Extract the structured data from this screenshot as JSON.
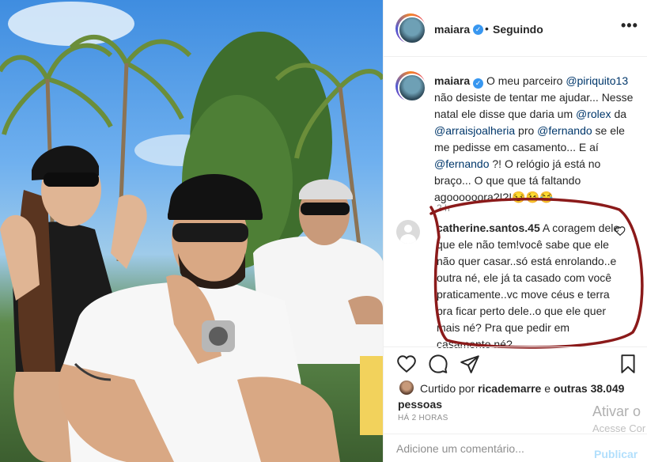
{
  "post": {
    "username": "maiara",
    "separator": "•",
    "follow_status": "Seguindo",
    "more": "•••"
  },
  "caption": {
    "username": "maiara",
    "text_1": "O meu parceiro ",
    "mention_1": "@piriquito13",
    "text_2": " não desiste de tentar me ajudar... Nesse natal ele disse que daria um ",
    "mention_2": "@rolex",
    "text_3": " da ",
    "mention_3": "@arraisjoalheria",
    "text_4": " pro ",
    "mention_4": "@fernando",
    "text_5": " se ele me pedisse em casamento... E aí ",
    "mention_5": "@fernando",
    "text_6": " ?! O relógio já está no braço... O que que tá faltando agoooooora?!?!😏😉😂",
    "time": "2 h"
  },
  "comment": {
    "username": "catherine.santos.45",
    "text": " A coragem dele que ele não tem!você sabe que ele não quer casar..só está enrolando..e outra né, ele já ta casado com você praticamente..vc move céus e terra pra ficar perto dele..o que ele quer mais né? Pra que pedir em casamento né?"
  },
  "likes": {
    "prefix": "Curtido por ",
    "user": "ricademarre",
    "middle": " e ",
    "others": "outras 38.049 pessoas"
  },
  "time_ago": "HÁ 2 HORAS",
  "add_comment": {
    "placeholder": "Adicione um comentário...",
    "publish": "Publicar"
  },
  "watermark": {
    "line1": "Ativar o",
    "line2": "Acesse Cor"
  },
  "colors": {
    "annotation": "#8b1a1a",
    "mention": "#00376b",
    "verified": "#3897f0",
    "publish_disabled": "#b2dffc"
  }
}
